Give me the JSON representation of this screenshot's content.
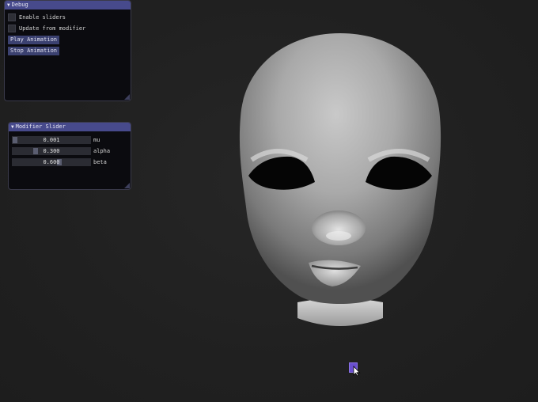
{
  "debug_panel": {
    "title": "Debug",
    "checkboxes": [
      {
        "label": "Enable sliders",
        "checked": false
      },
      {
        "label": "Update from modifier",
        "checked": false
      }
    ],
    "buttons": [
      "Play Animation",
      "Stop Animation"
    ]
  },
  "modifier_panel": {
    "title": "Modifier Slider",
    "sliders": [
      {
        "label": "mu",
        "value": "0.001",
        "fraction": 0.04
      },
      {
        "label": "alpha",
        "value": "0.300",
        "fraction": 0.3
      },
      {
        "label": "beta",
        "value": "0.600",
        "fraction": 0.6
      }
    ]
  },
  "colors": {
    "background": "#222222",
    "title_bar": "#474a8c",
    "button": "#3b4170",
    "cursor_accent": "#6a4fd0"
  }
}
